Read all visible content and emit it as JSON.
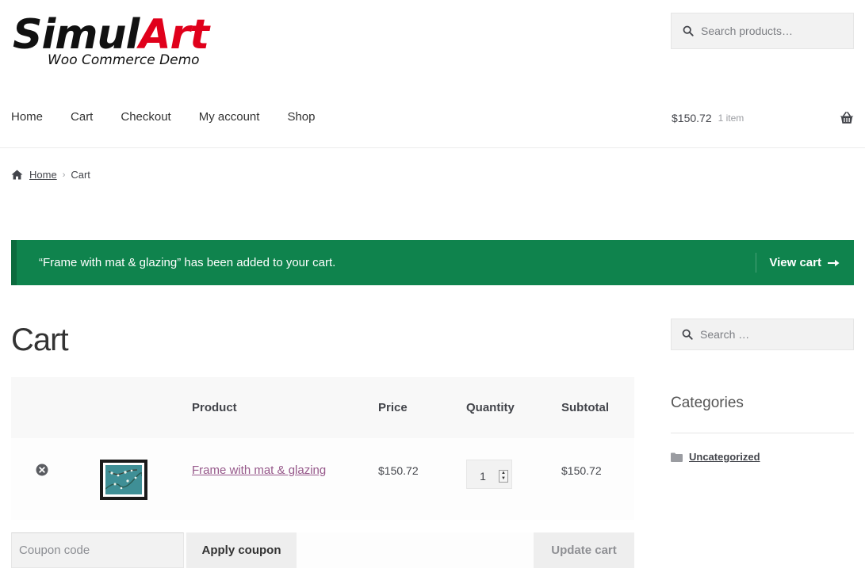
{
  "site": {
    "logo_main_a": "Simul",
    "logo_main_b": "Art",
    "logo_sub": "Woo Commerce Demo",
    "header_search_placeholder": "Search products…"
  },
  "nav": {
    "items": [
      {
        "label": "Home"
      },
      {
        "label": "Cart"
      },
      {
        "label": "Checkout"
      },
      {
        "label": "My account"
      },
      {
        "label": "Shop"
      }
    ]
  },
  "header_cart": {
    "amount": "$150.72",
    "count": "1 item",
    "icon": "basket-icon"
  },
  "breadcrumb": {
    "home": "Home",
    "separator": "›",
    "current": "Cart"
  },
  "notice": {
    "message": "“Frame with mat & glazing” has been added to your cart.",
    "button": "View cart",
    "color": "#0f834d"
  },
  "cart": {
    "title": "Cart",
    "columns": {
      "product": "Product",
      "price": "Price",
      "quantity": "Quantity",
      "subtotal": "Subtotal"
    },
    "items": [
      {
        "name": "Frame with mat & glazing",
        "price": "$150.72",
        "quantity": "1",
        "subtotal": "$150.72"
      }
    ],
    "coupon_placeholder": "Coupon code",
    "apply_label": "Apply coupon",
    "update_label": "Update cart"
  },
  "sidebar": {
    "search_placeholder": "Search …",
    "categories_title": "Categories",
    "categories": [
      {
        "label": "Uncategorized"
      }
    ]
  },
  "colors": {
    "link": "#96588a",
    "notice": "#0f834d",
    "logo_accent": "#e0001b"
  }
}
